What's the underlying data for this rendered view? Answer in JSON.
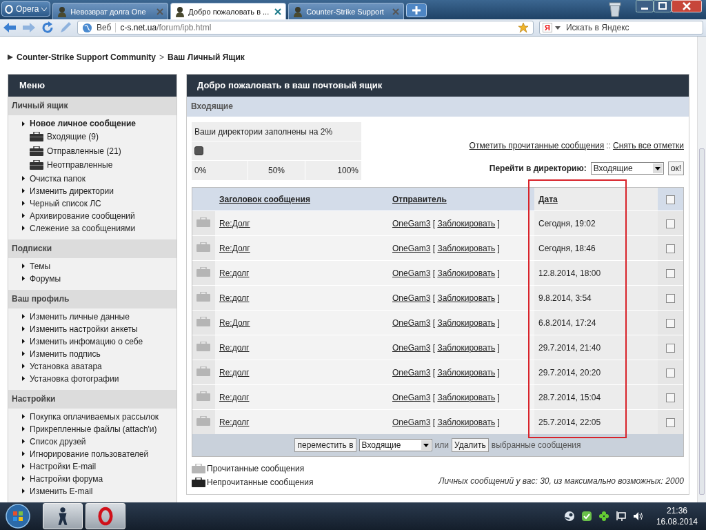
{
  "browser": {
    "opera_button": "Opera",
    "tabs": [
      {
        "title": "Невозврат долга One",
        "selected": false
      },
      {
        "title": "Добро пожаловать в ...",
        "selected": true
      },
      {
        "title": "Counter-Strike Support",
        "selected": false
      }
    ],
    "address": {
      "scheme_label": "Веб",
      "host": "c-s.net.ua",
      "path": "/forum/ipb.html"
    },
    "search": {
      "engine_mark": "Я",
      "placeholder": "Искать в Яндекс"
    }
  },
  "breadcrumb": {
    "items": [
      "Counter-Strike Support Community",
      "Ваш Личный Ящик"
    ],
    "separator": ">"
  },
  "sidebar": {
    "title": "Меню",
    "sections": [
      {
        "title": "Личный ящик",
        "items": [
          {
            "label": "Новое личное сообщение",
            "kind": "primary"
          },
          {
            "label": "Входящие (9)",
            "kind": "folder"
          },
          {
            "label": "Отправленные (21)",
            "kind": "folder"
          },
          {
            "label": "Неотправленные",
            "kind": "folder"
          },
          {
            "label": "Очистка папок",
            "kind": "link"
          },
          {
            "label": "Изменить директории",
            "kind": "link"
          },
          {
            "label": "Черный список ЛС",
            "kind": "link"
          },
          {
            "label": "Архивирование сообщений",
            "kind": "link"
          },
          {
            "label": "Слежение за сообщениями",
            "kind": "link"
          }
        ]
      },
      {
        "title": "Подписки",
        "items": [
          {
            "label": "Темы",
            "kind": "link"
          },
          {
            "label": "Форумы",
            "kind": "link"
          }
        ]
      },
      {
        "title": "Ваш профиль",
        "items": [
          {
            "label": "Изменить личные данные",
            "kind": "link"
          },
          {
            "label": "Изменить настройки анкеты",
            "kind": "link"
          },
          {
            "label": "Изменить инфомацию о себе",
            "kind": "link"
          },
          {
            "label": "Изменить подпись",
            "kind": "link"
          },
          {
            "label": "Установка аватара",
            "kind": "link"
          },
          {
            "label": "Установка фотографии",
            "kind": "link"
          }
        ]
      },
      {
        "title": "Настройки",
        "items": [
          {
            "label": "Покупка оплачиваемых рассылок",
            "kind": "link"
          },
          {
            "label": "Прикрепленные файлы (attach'и)",
            "kind": "link"
          },
          {
            "label": "Список друзей",
            "kind": "link"
          },
          {
            "label": "Игнорирование пользователей",
            "kind": "link"
          },
          {
            "label": "Настройки E-mail",
            "kind": "link"
          },
          {
            "label": "Настройки форума",
            "kind": "link"
          },
          {
            "label": "Изменить E-mail",
            "kind": "link"
          }
        ]
      }
    ]
  },
  "main": {
    "title": "Добро пожаловать в ваш почтовый ящик",
    "folder_title": "Входящие",
    "quota": {
      "text": "Ваши директории заполнены на 2%",
      "level": 0.02,
      "scale": [
        "0%",
        "50%",
        "100%"
      ]
    },
    "mark_links": [
      "Отметить прочитанные сообщения",
      "Снять все отметки"
    ],
    "mark_separator": "::",
    "jump": {
      "label": "Перейти в директорию:",
      "value": "Входящие",
      "button": "ок!"
    },
    "table": {
      "columns": [
        {
          "label": "Заголовок сообщения",
          "highlighted": false
        },
        {
          "label": "Отправитель",
          "highlighted": false
        },
        {
          "label": "Дата",
          "highlighted": true
        }
      ],
      "select_all_checked": false,
      "block_brackets": [
        "[",
        "]"
      ],
      "rows": [
        {
          "title": "Re:Долг",
          "sender": "OneGam3",
          "block": "Заблокировать",
          "date": "Сегодня, 19:02",
          "read": true,
          "checked": false
        },
        {
          "title": "Re:Долг",
          "sender": "OneGam3",
          "block": "Заблокировать",
          "date": "Сегодня, 18:46",
          "read": true,
          "checked": false
        },
        {
          "title": "Re:долг",
          "sender": "OneGam3",
          "block": "Заблокировать",
          "date": "12.8.2014, 18:00",
          "read": true,
          "checked": false
        },
        {
          "title": "Re:долг",
          "sender": "OneGam3",
          "block": "Заблокировать",
          "date": "9.8.2014, 3:54",
          "read": true,
          "checked": false
        },
        {
          "title": "Re:Долг",
          "sender": "OneGam3",
          "block": "Заблокировать",
          "date": "6.8.2014, 17:24",
          "read": true,
          "checked": false
        },
        {
          "title": "Re:долг",
          "sender": "OneGam3",
          "block": "Заблокировать",
          "date": "29.7.2014, 21:40",
          "read": true,
          "checked": false
        },
        {
          "title": "Re:долг",
          "sender": "OneGam3",
          "block": "Заблокировать",
          "date": "29.7.2014, 20:20",
          "read": true,
          "checked": false
        },
        {
          "title": "Re:долг",
          "sender": "OneGam3",
          "block": "Заблокировать",
          "date": "28.7.2014, 15:04",
          "read": true,
          "checked": false
        },
        {
          "title": "Re:долг",
          "sender": "OneGam3",
          "block": "Заблокировать",
          "date": "25.7.2014, 22:05",
          "read": true,
          "checked": false
        }
      ],
      "footer": {
        "move_button": "переместить в",
        "target": "Входящие",
        "or": "или",
        "delete_button": "Удалить",
        "tail": "выбранные сообщения"
      }
    },
    "legend": [
      {
        "label": "Прочитанные сообщения",
        "read": true
      },
      {
        "label": "Непрочитанные сообщения",
        "read": false
      }
    ],
    "count": "Личных сообщений у вас: 30, из максимально возможных: 2000"
  },
  "taskbar": {
    "time": "21:36",
    "date": "16.08.2014"
  }
}
